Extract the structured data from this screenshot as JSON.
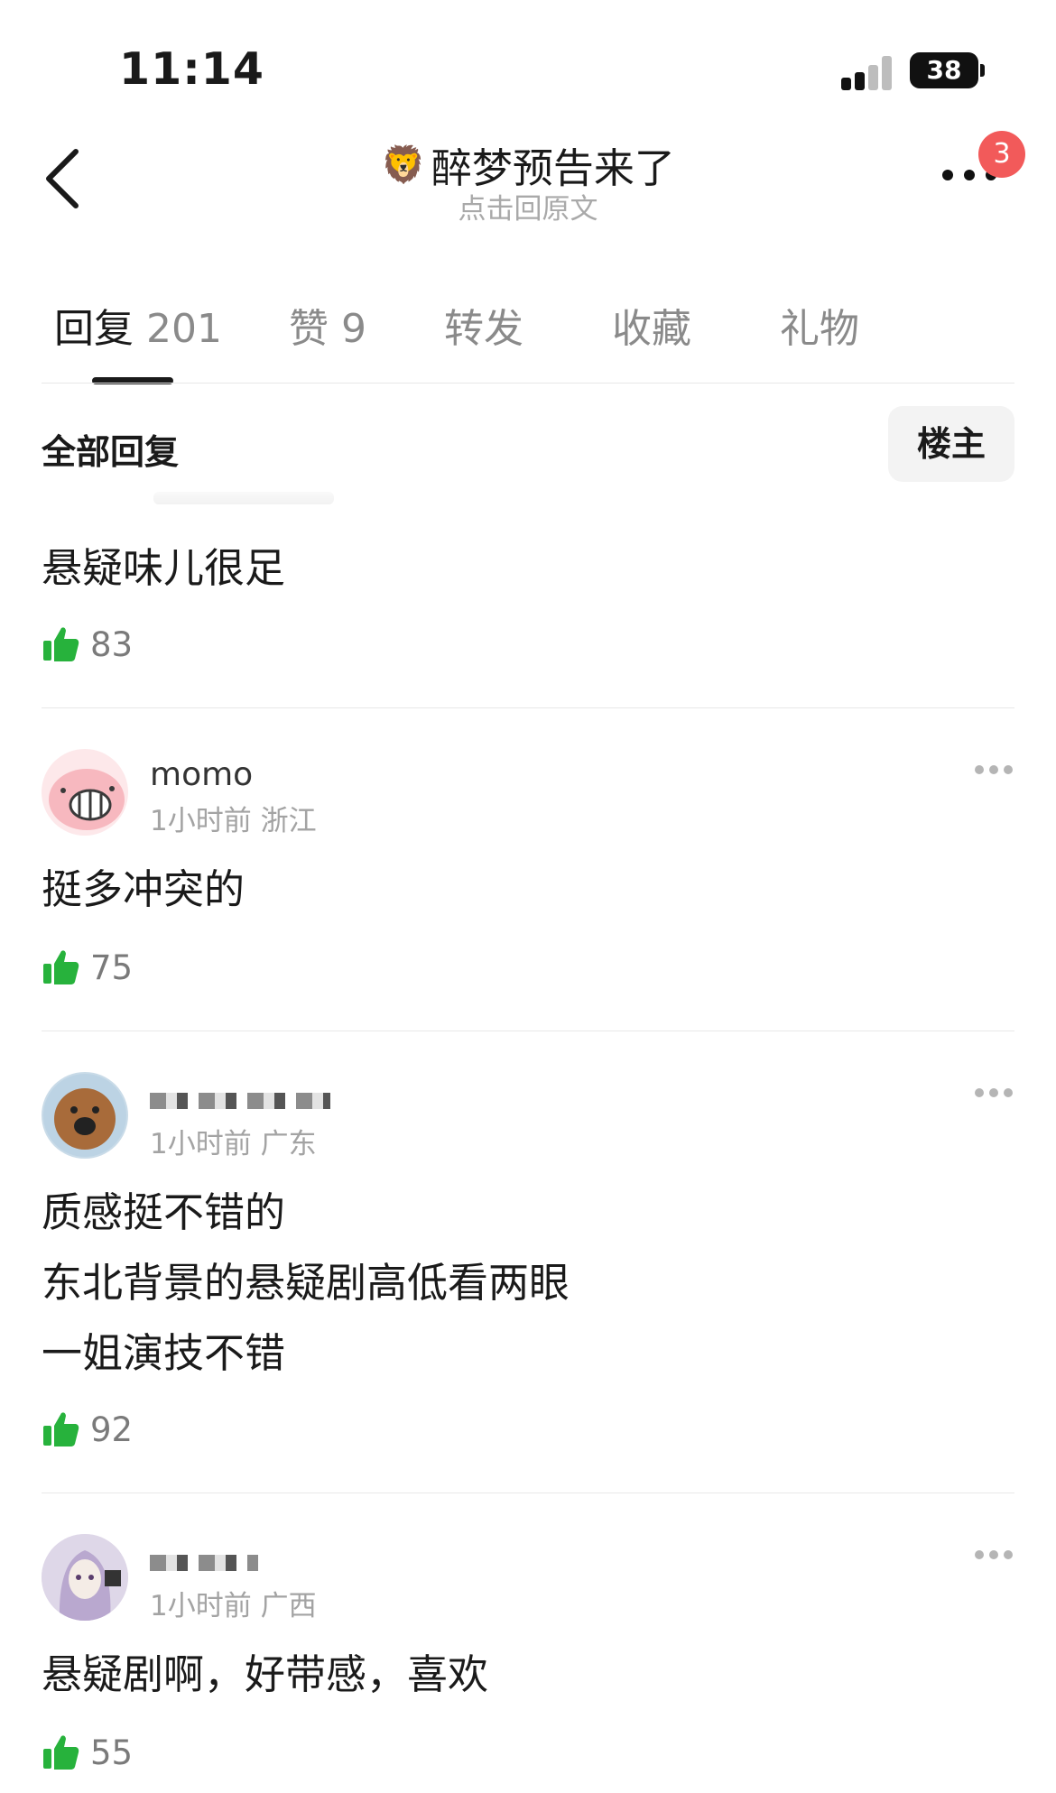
{
  "status_bar": {
    "time": "11:14",
    "battery": "38"
  },
  "header": {
    "title": "醉梦预告来了",
    "subtitle": "点击回原文",
    "badge": "3"
  },
  "tabs": [
    {
      "label": "回复",
      "count": "201"
    },
    {
      "label": "赞",
      "count": "9"
    },
    {
      "label": "转发"
    },
    {
      "label": "收藏"
    },
    {
      "label": "礼物"
    }
  ],
  "section": {
    "title": "全部回复",
    "owner_button": "楼主"
  },
  "comments": [
    {
      "text": "悬疑味儿很足",
      "likes": "83"
    },
    {
      "username": "momo",
      "time": "1小时前",
      "location": "浙江",
      "text": "挺多冲突的",
      "likes": "75"
    },
    {
      "time": "1小时前",
      "location": "广东",
      "lines": [
        "质感挺不错的",
        "东北背景的悬疑剧高低看两眼",
        "一姐演技不错"
      ],
      "likes": "92"
    },
    {
      "time": "1小时前",
      "location": "广西",
      "text": "悬疑剧啊，好带感，喜欢",
      "likes": "55"
    }
  ],
  "colors": {
    "like_green": "#27b23c",
    "badge_red": "#f25a5a"
  }
}
